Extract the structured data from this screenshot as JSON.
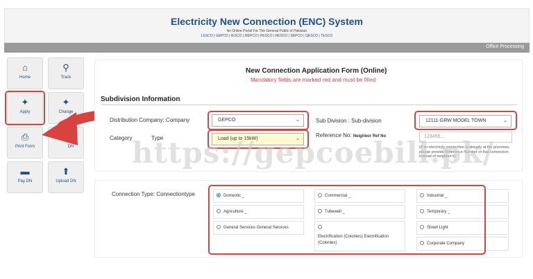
{
  "header": {
    "title": "Electricity New Connection (ENC) System",
    "subtitle": "An Online Portal For The General Public of Pakistan",
    "companies": "LESCO | GEPCO | IESCO | MEPCO | PESCO | HESCO | SEPCO | QESCO | TESCO",
    "office_link": "Office Processing"
  },
  "sidebar": [
    {
      "label": "Home",
      "icon": "home-icon"
    },
    {
      "label": "Track",
      "icon": "search-icon"
    },
    {
      "label": "Apply",
      "icon": "magic-wand-icon"
    },
    {
      "label": "Change",
      "icon": "magic-wand-icon"
    },
    {
      "label": "Print Form",
      "icon": "print-icon"
    },
    {
      "label": "DN",
      "icon": "document-icon"
    },
    {
      "label": "Pay DN",
      "icon": "card-icon"
    },
    {
      "label": "Upload DN",
      "icon": "upload-icon"
    }
  ],
  "form": {
    "title": "New Connection Application Form (Online)",
    "mandatory_note": "Mandatory fields are marked red and must be filled",
    "section": "Subdivision Information",
    "distribution_label": "Distribution Company: Company",
    "distribution_value": "GEPCO",
    "subdivision_label": "Sub Division : Sub-division",
    "subdivision_value": "12111-GRW MODEL TOWN",
    "category_label": "Category  Type",
    "category_label_left": "Category",
    "category_label_right": "Type",
    "category_value": "Load (up to 15kW)",
    "reference_label": "Reference No:",
    "reference_sublabel": "Neighbor Ref No",
    "reference_placeholder": "123456....",
    "reference_note": "(If an electricity connection is already at the premises, please provide Reference Number of that connection instead of neighbor's)",
    "connection_label": "Connection Type: Connectiontype",
    "connection_types": [
      {
        "label": "Domestic  _",
        "checked": true
      },
      {
        "label": "Commercial  _",
        "checked": false
      },
      {
        "label": "Industrial  _",
        "checked": false
      },
      {
        "label": "Agriculture  _",
        "checked": false
      },
      {
        "label": "Tubewell  _",
        "checked": false
      },
      {
        "label": "Temporary  _",
        "checked": false
      },
      {
        "label": "General Services   General Services",
        "checked": false
      },
      {
        "label": "Electrification (Colonies)   Electrification (Colonies)",
        "checked": false
      },
      {
        "label": "Street   Light",
        "checked": false
      },
      {
        "label": "Corporate   Company",
        "checked": false
      }
    ]
  },
  "watermark": "https://gepcoebill.pk/",
  "colors": {
    "brand": "#1d4f8a",
    "highlight": "#d9433f",
    "selected_field": "#fdfbcf"
  }
}
